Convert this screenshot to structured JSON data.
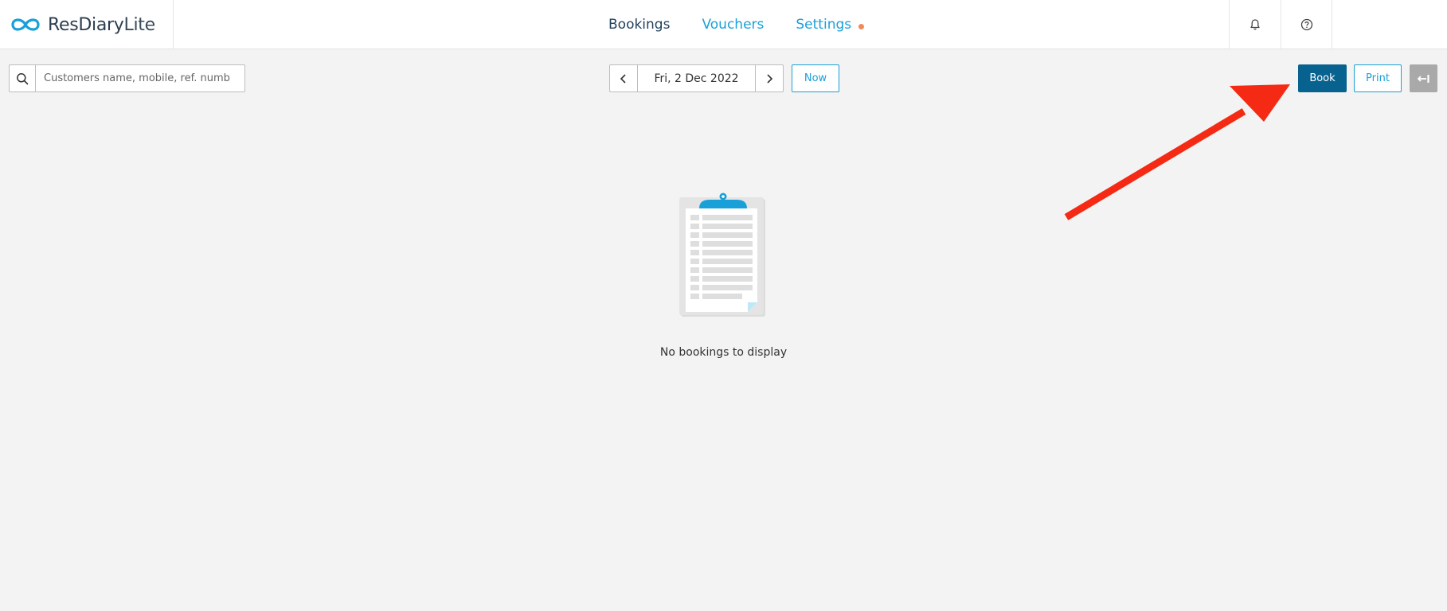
{
  "app": {
    "logo_main": "ResDiary",
    "logo_sub": "Lite"
  },
  "nav": {
    "items": [
      {
        "label": "Bookings"
      },
      {
        "label": "Vouchers"
      },
      {
        "label": "Settings"
      }
    ]
  },
  "header_icons": [
    "bell-icon",
    "help-icon"
  ],
  "search": {
    "placeholder": "Customers name, mobile, ref. numb",
    "value": ""
  },
  "date_nav": {
    "date": "Fri, 2 Dec 2022",
    "now_label": "Now"
  },
  "actions": {
    "book_label": "Book",
    "print_label": "Print"
  },
  "empty_state": {
    "message": "No bookings to display"
  },
  "colors": {
    "brand_blue": "#1aa0d8",
    "book_button": "#08628f",
    "settings_dot": "#f08a5d",
    "annotation_arrow": "#f42a14"
  }
}
